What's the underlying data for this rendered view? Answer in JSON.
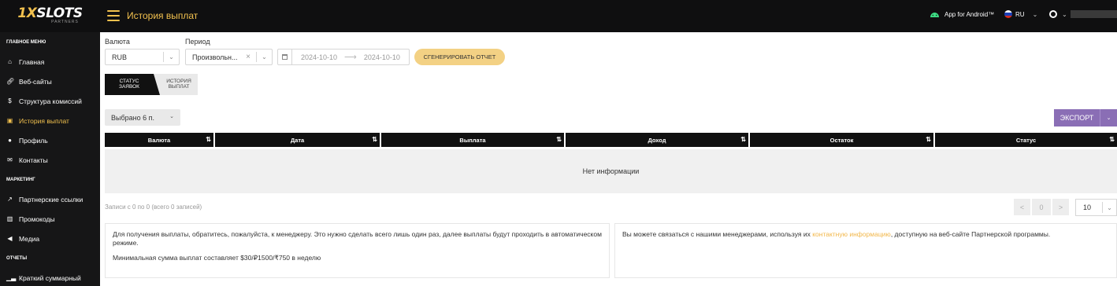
{
  "brand": {
    "logo_main": "1XSLOTS",
    "logo_prefix": "1X",
    "logo_rest": "SLOTS",
    "logo_sub": "PARTNERS",
    "accent": "#f2c14e"
  },
  "header": {
    "title": "История выплат",
    "android_label": "App for Android™",
    "lang": "RU"
  },
  "sidebar": {
    "sections": [
      {
        "title": "ГЛАВНОЕ МЕНЮ",
        "items": [
          {
            "label": "Главная",
            "icon": "home-icon"
          },
          {
            "label": "Веб-сайты",
            "icon": "link-icon"
          },
          {
            "label": "Структура комиссий",
            "icon": "dollar-icon"
          },
          {
            "label": "История выплат",
            "icon": "wallet-icon",
            "active": true
          },
          {
            "label": "Профиль",
            "icon": "user-icon"
          },
          {
            "label": "Контакты",
            "icon": "envelope-icon"
          }
        ]
      },
      {
        "title": "МАРКЕТИНГ",
        "items": [
          {
            "label": "Партнерские ссылки",
            "icon": "external-link-icon"
          },
          {
            "label": "Промокоды",
            "icon": "barcode-icon"
          },
          {
            "label": "Медиа",
            "icon": "megaphone-icon"
          }
        ]
      },
      {
        "title": "ОТЧЕТЫ",
        "items": [
          {
            "label": "Краткий суммарный",
            "icon": "chart-icon"
          }
        ]
      }
    ]
  },
  "filters": {
    "currency_label": "Валюта",
    "currency_value": "RUB",
    "period_label": "Период",
    "period_value": "Произвольн...",
    "date_from": "2024-10-10",
    "date_to": "2024-10-10",
    "generate_label": "СГЕНЕРИРОВАТЬ ОТЧЕТ"
  },
  "tabs": {
    "active_line1": "СТАТУС",
    "active_line2": "ЗАЯВОК",
    "inactive_line1": "ИСТОРИЯ",
    "inactive_line2": "ВЫПЛАТ"
  },
  "toolbar": {
    "selected_label": "Выбрано 6 п.",
    "export_label": "ЭКСПОРТ"
  },
  "table": {
    "columns": [
      "Валюта",
      "Дата",
      "Выплата",
      "Доход",
      "Остаток",
      "Статус"
    ],
    "empty_text": "Нет информации"
  },
  "pagination": {
    "info": "Записи с 0 по 0 (всего 0 записей)",
    "prev": "<",
    "current": "0",
    "next": ">",
    "per_page": "10"
  },
  "cards": {
    "left_p1": "Для получения выплаты, обратитесь, пожалуйста, к менеджеру. Это нужно сделать всего лишь один раз, далее выплаты будут проходить в автоматическом режиме.",
    "left_p2": "Минимальная сумма выплат составляет $30/₽1500/₹750 в неделю",
    "right_before": "Вы можете связаться с нашими менеджерами, используя их ",
    "right_link": "контактную информацию",
    "right_after": ", доступную на веб-сайте Партнерской программы."
  }
}
